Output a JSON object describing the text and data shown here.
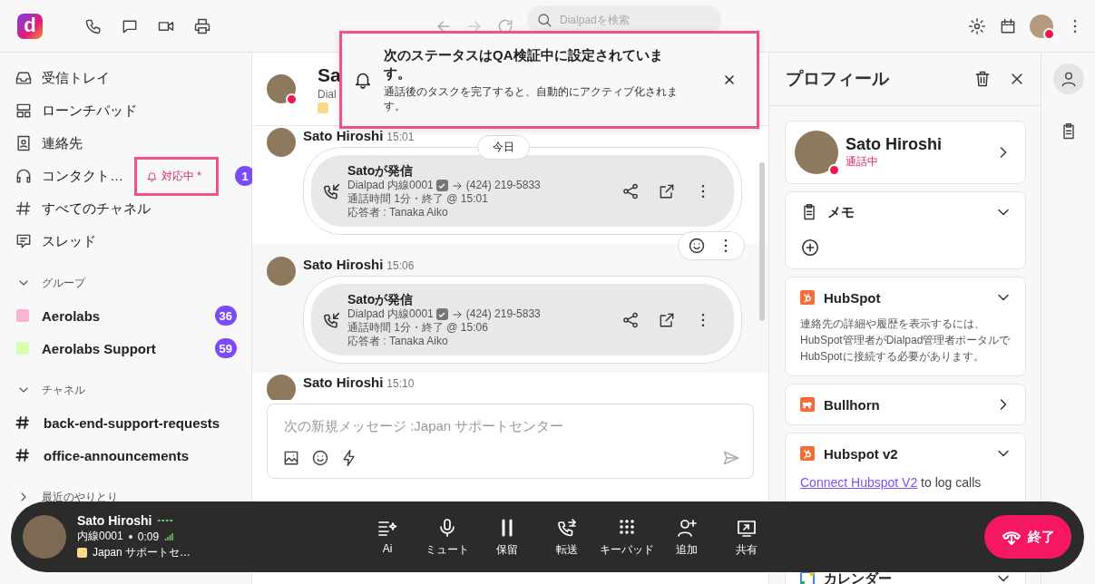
{
  "app": {
    "logo_text": "d"
  },
  "topbar": {
    "search": {
      "placeholder": "Dialpadを検索"
    }
  },
  "sidebar": {
    "nav": [
      {
        "label": "受信トレイ"
      },
      {
        "label": "ローンチパッド"
      },
      {
        "label": "連絡先"
      },
      {
        "label": "コンタクト…",
        "status": "対応中 *",
        "count": "1"
      },
      {
        "label": "すべてのチャネル"
      },
      {
        "label": "スレッド"
      }
    ],
    "sections": [
      {
        "title": "グループ",
        "expanded": true,
        "items": [
          {
            "kind": "group",
            "label": "Aerolabs",
            "color": "#f9b4cf",
            "count": "36"
          },
          {
            "kind": "group",
            "label": "Aerolabs Support",
            "color": "#dcfbb4",
            "count": "59"
          }
        ]
      },
      {
        "title": "チャネル",
        "expanded": true,
        "items": [
          {
            "kind": "channel",
            "label": "back-end-support-requests"
          },
          {
            "kind": "channel",
            "label": "office-announcements"
          }
        ]
      },
      {
        "title": "最近のやりとり",
        "expanded": false
      }
    ]
  },
  "chat": {
    "header": {
      "name": "Sa",
      "subtitle": "Dial"
    },
    "date": "今日",
    "messages": [
      {
        "author": "Sato Hiroshi",
        "time": "15:01",
        "hovered": false,
        "call": {
          "title": "Satoが発信",
          "line": "Dialpad 内線0001",
          "number": "(424) 219-5833",
          "duration": "通話時間 1分・終了 @ 15:01",
          "answered": "応答者 : Tanaka Aiko"
        }
      },
      {
        "author": "Sato Hiroshi",
        "time": "15:06",
        "hovered": true,
        "call": {
          "title": "Satoが発信",
          "line": "Dialpad 内線0001",
          "number": "(424) 219-5833",
          "duration": "通話時間 1分・終了 @ 15:06",
          "answered": "応答者 : Tanaka Aiko"
        }
      },
      {
        "author": "Sato Hiroshi",
        "time": "15:10",
        "hovered": false
      }
    ],
    "composer": {
      "placeholder": "次の新規メッセージ :Japan サポートセンター"
    }
  },
  "toast": {
    "title": "次のステータスはQA検証中に設定されています。",
    "body": "通話後のタスクを完了すると、自動的にアクティブ化されます。"
  },
  "profile": {
    "title": "プロフィール",
    "contact": {
      "name": "Sato Hiroshi",
      "status": "通話中"
    },
    "cards": [
      {
        "kind": "memo",
        "title": "メモ",
        "expanded": true
      },
      {
        "kind": "hubspot",
        "title": "HubSpot",
        "expanded": true,
        "text": "連絡先の詳細や履歴を表示するには、HubSpot管理者がDialpad管理者ポータルでHubSpotに接続する必要があります。"
      },
      {
        "kind": "bullhorn",
        "title": "Bullhorn",
        "expanded": false
      },
      {
        "kind": "hubspot",
        "title": "Hubspot v2",
        "expanded": true,
        "link": "Connect Hubspot V2",
        "text": "to log calls"
      },
      {
        "kind": "calendar",
        "title": "カレンダー",
        "expanded": true
      }
    ]
  },
  "rail": [
    {
      "selected": true
    },
    {
      "selected": false
    }
  ],
  "callbar": {
    "name": "Sato Hiroshi",
    "line": "内線0001",
    "timer": "0:09",
    "queue": "Japan サポートセ…",
    "actions": [
      {
        "label": "Ai"
      },
      {
        "label": "ミュート"
      },
      {
        "label": "保留"
      },
      {
        "label": "転送"
      },
      {
        "label": "キーパッド"
      },
      {
        "label": "追加"
      },
      {
        "label": "共有"
      }
    ],
    "end": "終了"
  }
}
